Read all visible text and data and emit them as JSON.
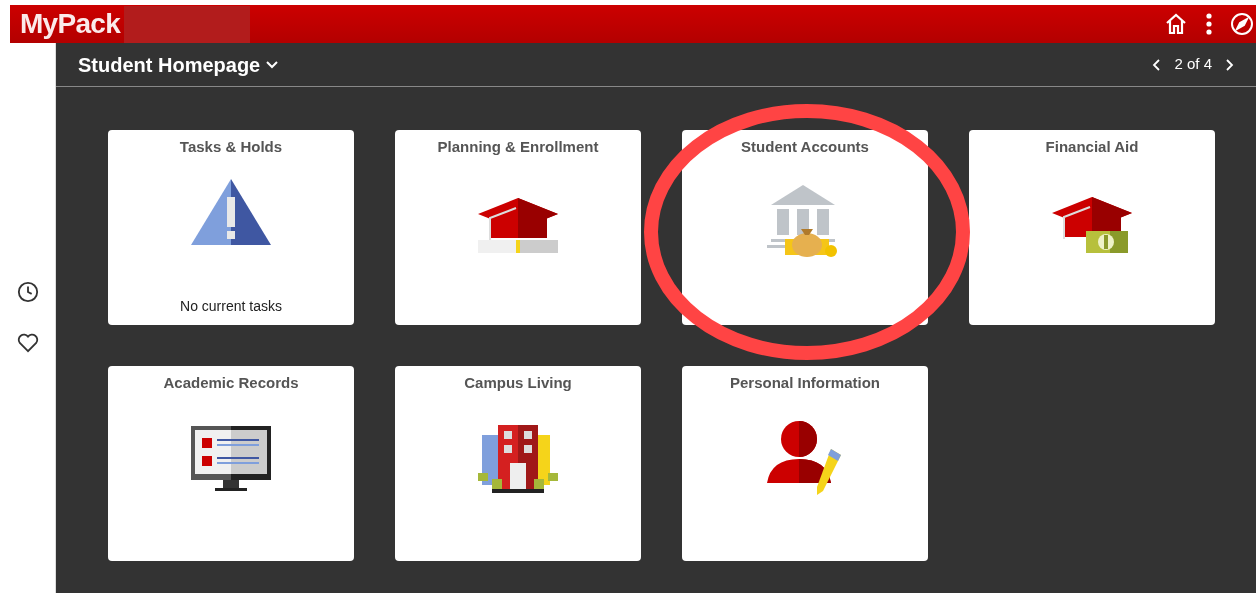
{
  "header": {
    "logo": "MyPack"
  },
  "title_bar": {
    "title": "Student Homepage",
    "pager": "2 of 4"
  },
  "tiles": [
    {
      "title": "Tasks & Holds",
      "kind": "warning",
      "note": "No current tasks"
    },
    {
      "title": "Planning & Enrollment",
      "kind": "cap-progress"
    },
    {
      "title": "Student Accounts",
      "kind": "bank"
    },
    {
      "title": "Financial Aid",
      "kind": "cap-money"
    },
    {
      "title": "Academic Records",
      "kind": "monitor"
    },
    {
      "title": "Campus Living",
      "kind": "buildings"
    },
    {
      "title": "Personal Information",
      "kind": "person-edit"
    }
  ]
}
